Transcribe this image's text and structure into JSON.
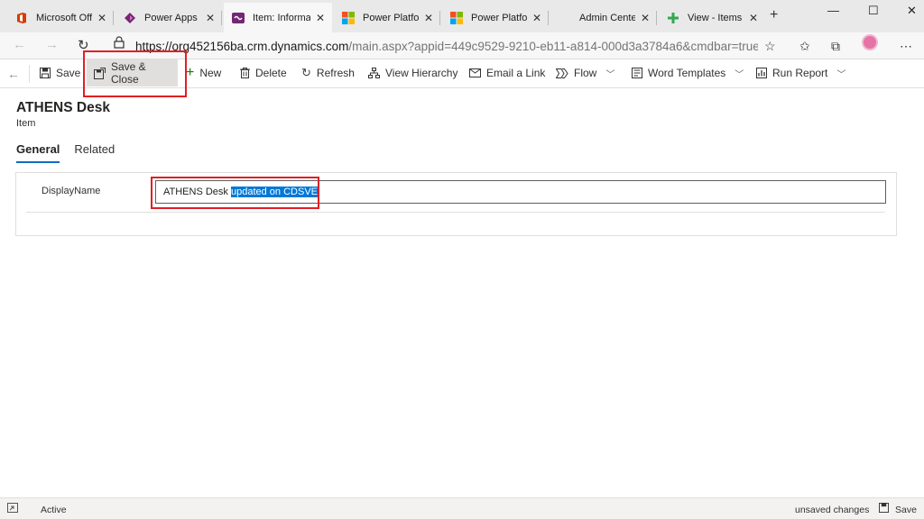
{
  "browser": {
    "tabs": [
      {
        "title": "Microsoft Office",
        "icon": "office-icon",
        "color": "#d83b01"
      },
      {
        "title": "Power Apps",
        "icon": "power-apps-icon",
        "color": "#742774"
      },
      {
        "title": "Item: Informatio",
        "icon": "dynamics-icon",
        "color": "#742774"
      },
      {
        "title": "Power Platform",
        "icon": "microsoft-logo-icon",
        "color": "#f25022"
      },
      {
        "title": "Power Platform",
        "icon": "microsoft-logo-icon",
        "color": "#f25022"
      },
      {
        "title": "Admin Center",
        "icon": "admin-icon",
        "color": "#888888"
      },
      {
        "title": "View - Items - D",
        "icon": "view-icon",
        "color": "#33a852"
      }
    ],
    "url_host": "https://org452156ba.crm.dynamics.com",
    "url_path": "/main.aspx?appid=449c9529-9210-eb11-a814-000d3a3784a6&cmdbar=true&f..."
  },
  "commands": {
    "save": "Save",
    "save_close": "Save & Close",
    "new": "New",
    "delete": "Delete",
    "refresh": "Refresh",
    "view_hierarchy": "View Hierarchy",
    "email_link": "Email a Link",
    "flow": "Flow",
    "word_templates": "Word Templates",
    "run_report": "Run Report"
  },
  "record": {
    "title": "ATHENS Desk",
    "type": "Item"
  },
  "form_tabs": [
    "General",
    "Related"
  ],
  "field": {
    "label": "DisplayName",
    "value_plain": "ATHENS Desk ",
    "value_selected": "updated on CDSVE"
  },
  "status": {
    "state": "Active",
    "unsaved": "unsaved changes",
    "save": "Save"
  },
  "colors": {
    "accent": "#0f6cbd",
    "highlight": "#e01f25",
    "selection": "#0078d7"
  }
}
